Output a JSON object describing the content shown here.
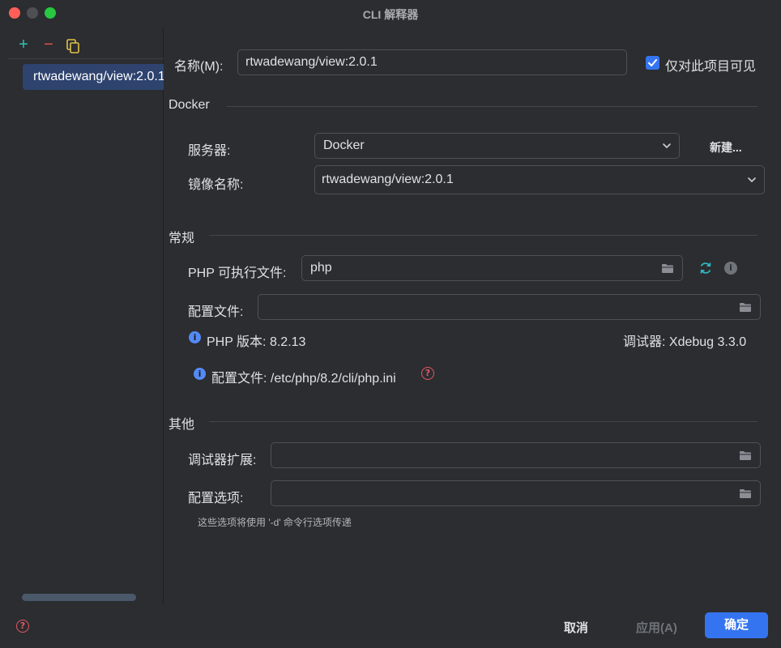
{
  "window": {
    "title": "CLI 解释器"
  },
  "sidebar": {
    "add_symbol": "+",
    "remove_symbol": "−",
    "items": [
      {
        "label": "rtwadewang/view:2.0.1"
      }
    ]
  },
  "name_row": {
    "label": "名称(M):",
    "value": "rtwadewang/view:2.0.1",
    "project_only_label": "仅对此项目可见",
    "project_only_checked": true
  },
  "docker": {
    "title": "Docker",
    "server_label": "服务器:",
    "server_value": "Docker",
    "new_button": "新建...",
    "image_label": "镜像名称:",
    "image_value": "rtwadewang/view:2.0.1"
  },
  "general": {
    "title": "常规",
    "php_exec_label": "PHP 可执行文件:",
    "php_exec_value": "php",
    "config_file_label": "配置文件:",
    "config_file_value": "",
    "php_version_text": "PHP 版本: 8.2.13",
    "debugger_text": "调试器: Xdebug 3.3.0",
    "config_path_text": "配置文件: /etc/php/8.2/cli/php.ini"
  },
  "other": {
    "title": "其他",
    "debugger_ext_label": "调试器扩展:",
    "debugger_ext_value": "",
    "config_options_label": "配置选项:",
    "config_options_value": "",
    "hint": "这些选项将使用 '-d' 命令行选项传递"
  },
  "footer": {
    "cancel": "取消",
    "apply": "应用(A)",
    "ok": "确定"
  },
  "colors": {
    "accent": "#3574f0",
    "background": "#2b2d30",
    "selection": "#2e436e",
    "error": "#e55765",
    "info": "#548af7",
    "add": "#2fc2b3"
  }
}
